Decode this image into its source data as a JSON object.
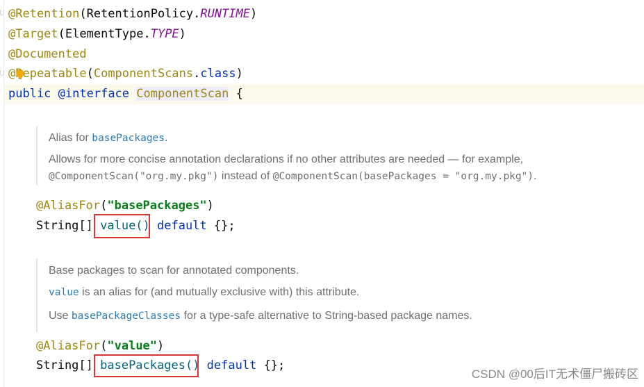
{
  "code": {
    "retention": {
      "annotation": "@Retention",
      "open": "(RetentionPolicy.",
      "value": "RUNTIME",
      "close": ")"
    },
    "target": {
      "annotation": "@Target",
      "open": "(ElementType.",
      "value": "TYPE",
      "close": ")"
    },
    "documented": {
      "annotation": "@Documented"
    },
    "repeatable": {
      "annotation": "@Repeatable",
      "open": "(",
      "arg": "ComponentScans",
      "dot": ".",
      "cls": "class",
      "close": ")"
    },
    "declaration": {
      "public": "public",
      "interface": "@interface",
      "name": "ComponentScan",
      "brace": " {"
    },
    "alias1": {
      "annotation": "@AliasFor",
      "open": "(",
      "value": "\"basePackages\"",
      "close": ")"
    },
    "value_method": {
      "type": "String[] ",
      "name": "value()",
      "default": "default",
      "rest": " {};"
    },
    "alias2": {
      "annotation": "@AliasFor",
      "open": "(",
      "value": "\"value\"",
      "close": ")"
    },
    "basepackages_method": {
      "type": "String[] ",
      "name": "basePackages()",
      "default": "default",
      "rest": " {};"
    }
  },
  "doc1": {
    "line1_prefix": "Alias for ",
    "line1_link": "basePackages",
    "line1_suffix": ".",
    "line2": "Allows for more concise annotation declarations if no other attributes are needed — for example,",
    "line3_code1": "@ComponentScan(\"org.my.pkg\")",
    "line3_mid": " instead of ",
    "line3_code2": "@ComponentScan(basePackages = \"org.my.pkg\")",
    "line3_end": "."
  },
  "doc2": {
    "line1": "Base packages to scan for annotated components.",
    "line2_link": "value",
    "line2_suffix": " is an alias for (and mutually exclusive with) this attribute.",
    "line3_prefix": "Use ",
    "line3_link": "basePackageClasses",
    "line3_suffix": " for a type-safe alternative to String-based package names."
  },
  "watermark": "CSDN @00后IT无术僵尸搬砖区",
  "colors": {
    "annotation": "#9e880d",
    "keyword": "#0033b3",
    "string": "#067d17",
    "link": "#2a7bb5",
    "highlight_box": "#d93636"
  }
}
